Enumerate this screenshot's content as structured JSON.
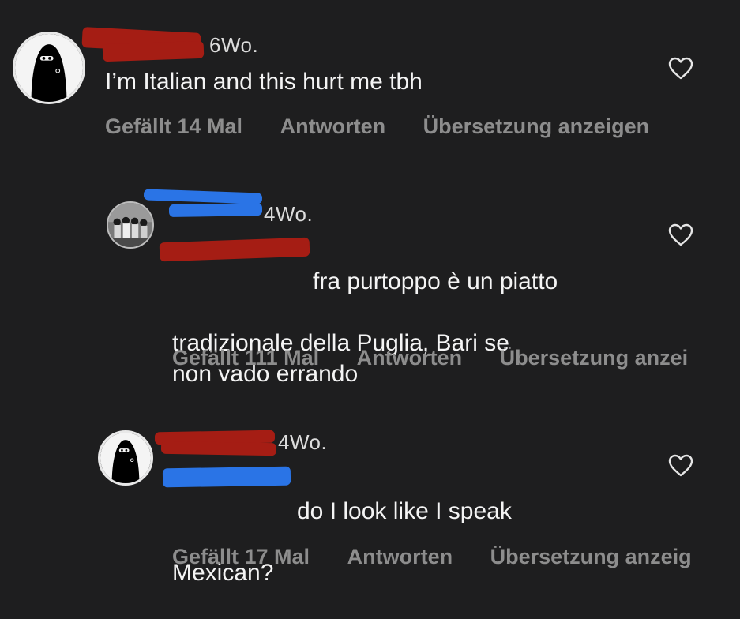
{
  "comments": [
    {
      "time": "6Wo.",
      "text": "I’m Italian and this hurt me tbh",
      "text_rest": "",
      "likes_label": "Gefällt 14 Mal",
      "reply_label": "Antworten",
      "translate_label": "Übersetzung anzeigen",
      "avatar": "veiled-figure-avatar",
      "heart_icon": "heart-outline-icon"
    },
    {
      "time": "4Wo.",
      "text": "fra purtoppo è un piatto",
      "text_rest": "tradizionale della Puglia, Bari se\nnon vado errando",
      "likes_label": "Gefällt 111 Mal",
      "reply_label": "Antworten",
      "translate_label": "Übersetzung anzei",
      "avatar": "group-photo-avatar",
      "heart_icon": "heart-outline-icon"
    },
    {
      "time": "4Wo.",
      "text": "do I look like I speak",
      "text_rest": "Mexican?",
      "likes_label": "Gefällt 17 Mal",
      "reply_label": "Antworten",
      "translate_label": "Übersetzung anzeig",
      "avatar": "veiled-figure-avatar",
      "heart_icon": "heart-outline-icon"
    }
  ],
  "colors": {
    "background": "#1e1e1f",
    "redaction_red": "#a51d14",
    "redaction_blue": "#2a74e6",
    "secondary_text": "#8d8d8d"
  }
}
